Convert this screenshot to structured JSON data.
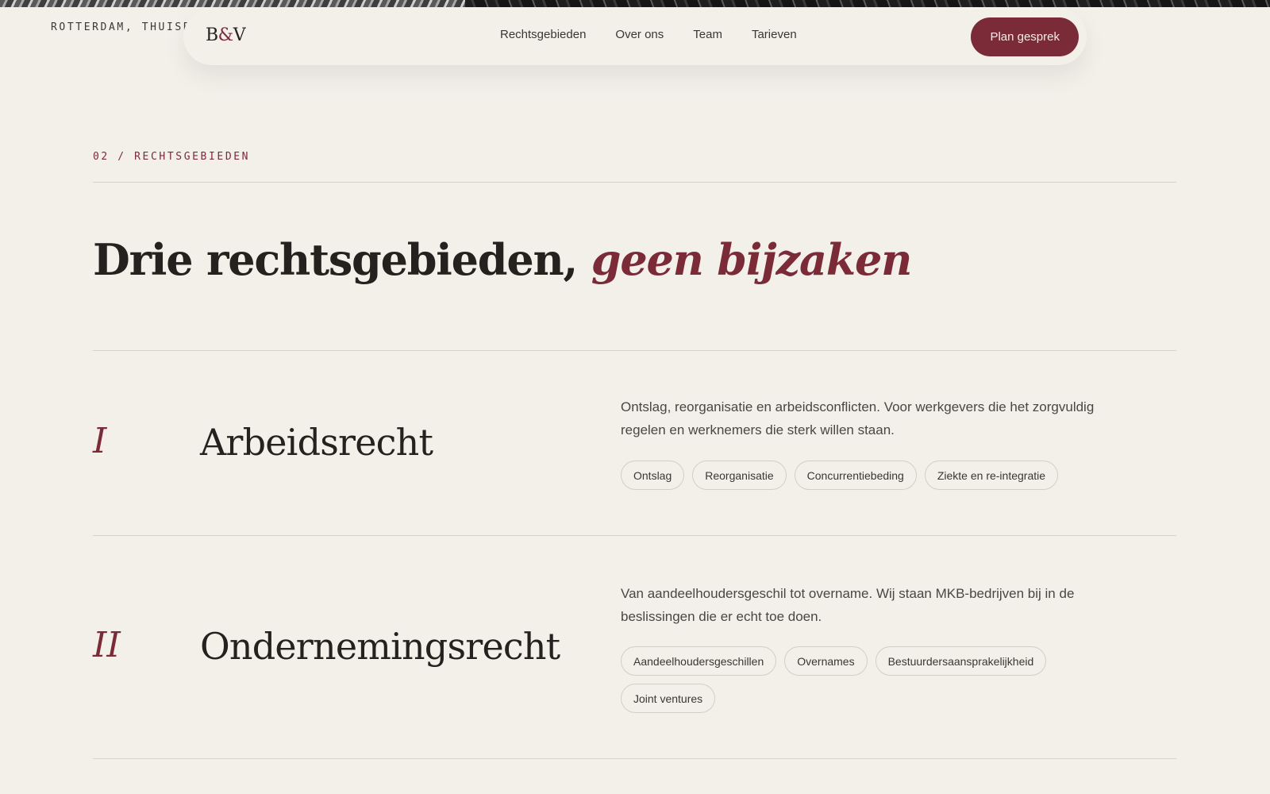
{
  "topbar": {
    "location": "ROTTERDAM, THUISB"
  },
  "nav": {
    "logo_left": "B",
    "logo_amp": "&",
    "logo_right": "V",
    "links": [
      "Rechtsgebieden",
      "Over ons",
      "Team",
      "Tarieven"
    ],
    "cta": "Plan gesprek"
  },
  "section": {
    "eyebrow": "02 / RECHTSGEBIEDEN",
    "headline_main": "Drie rechtsgebieden, ",
    "headline_accent": "geen bijzaken"
  },
  "areas": [
    {
      "numeral": "I",
      "title": "Arbeidsrecht",
      "description": "Ontslag, reorganisatie en arbeidsconflicten. Voor werkgevers die het zorgvuldig regelen en werknemers die sterk willen staan.",
      "tags": [
        "Ontslag",
        "Reorganisatie",
        "Concurrentiebeding",
        "Ziekte en re-integratie"
      ]
    },
    {
      "numeral": "II",
      "title": "Ondernemingsrecht",
      "description": "Van aandeelhoudersgeschil tot overname. Wij staan MKB-bedrijven bij in de beslissingen die er echt toe doen.",
      "tags": [
        "Aandeelhoudersgeschillen",
        "Overnames",
        "Bestuurdersaansprakelijkheid",
        "Joint ventures"
      ]
    }
  ],
  "colors": {
    "accent": "#7b2a37",
    "background": "#f3f0ea",
    "text": "#24211f"
  }
}
